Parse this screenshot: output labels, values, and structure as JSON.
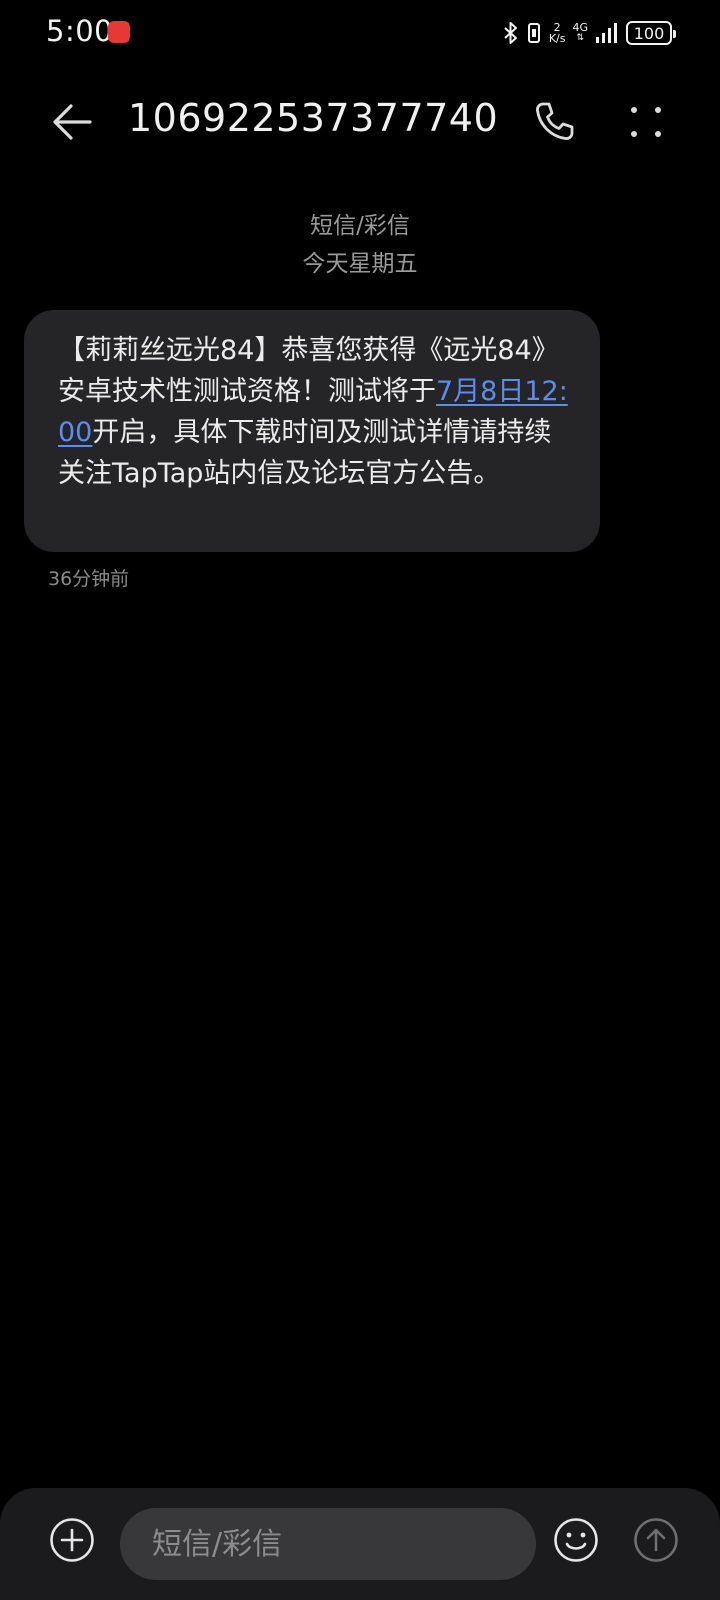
{
  "status_bar": {
    "time": "5:00",
    "network_speed_value": "2",
    "network_speed_unit": "K/s",
    "network_type": "4G",
    "battery": "100",
    "icons": [
      "app-notification-icon",
      "bluetooth-icon",
      "vibrate-icon",
      "signal-icon",
      "battery-icon"
    ]
  },
  "header": {
    "title": "106922537377740",
    "icons": [
      "back-arrow-icon",
      "phone-icon",
      "more-icon"
    ]
  },
  "conversation": {
    "message_type_label": "短信/彩信",
    "date_label": "今天星期五",
    "messages": [
      {
        "text_before": "【莉莉丝远光84】恭喜您获得《远光84》安卓技术性测试资格！测试将于",
        "link_text": "7月8日12:00",
        "text_after": "开启，具体下载时间及测试详情请持续关注TapTap站内信及论坛官方公告。",
        "time": "36分钟前"
      }
    ]
  },
  "composer": {
    "placeholder": "短信/彩信",
    "icons": [
      "add-icon",
      "emoji-icon",
      "send-icon"
    ]
  },
  "colors": {
    "background": "#000000",
    "bubble": "#252527",
    "link": "#5b8dee",
    "composer_bar": "#1b1b1d",
    "input": "#38383b"
  }
}
